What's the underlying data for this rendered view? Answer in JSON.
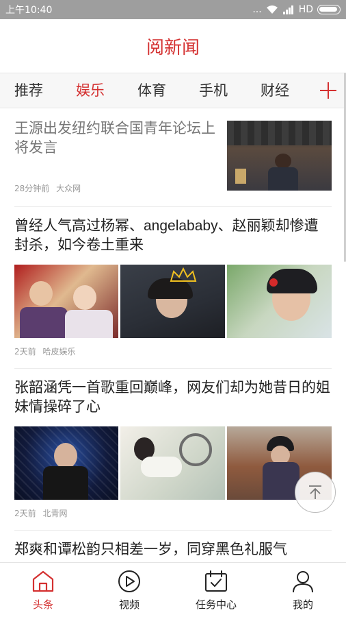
{
  "status": {
    "time": "上午10:40",
    "dots": "...",
    "network": "HD"
  },
  "header": {
    "title": "阅新闻"
  },
  "tabs": [
    "推荐",
    "娱乐",
    "体育",
    "手机",
    "财经"
  ],
  "tabs_active": "娱乐",
  "articles": [
    {
      "headline": "王源出发纽约联合国青年论坛上将发言",
      "time": "28分钟前",
      "source": "大众网"
    },
    {
      "headline": "曾经人气高过杨幂、angelababy、赵丽颖却惨遭封杀，如今卷土重来",
      "time": "2天前",
      "source": "哈皮娱乐"
    },
    {
      "headline": "张韶涵凭一首歌重回巅峰，网友们却为她昔日的姐妹情操碎了心",
      "time": "2天前",
      "source": "北青网"
    },
    {
      "headline": "郑爽和谭松韵只相差一岁，同穿黑色礼服气"
    }
  ],
  "bottom_nav": [
    {
      "label": "头条",
      "icon": "home-icon"
    },
    {
      "label": "视频",
      "icon": "play-icon"
    },
    {
      "label": "任务中心",
      "icon": "calendar-check-icon"
    },
    {
      "label": "我的",
      "icon": "user-icon"
    }
  ],
  "colors": {
    "accent": "#d43030",
    "statusbar": "#9e9e9e"
  }
}
